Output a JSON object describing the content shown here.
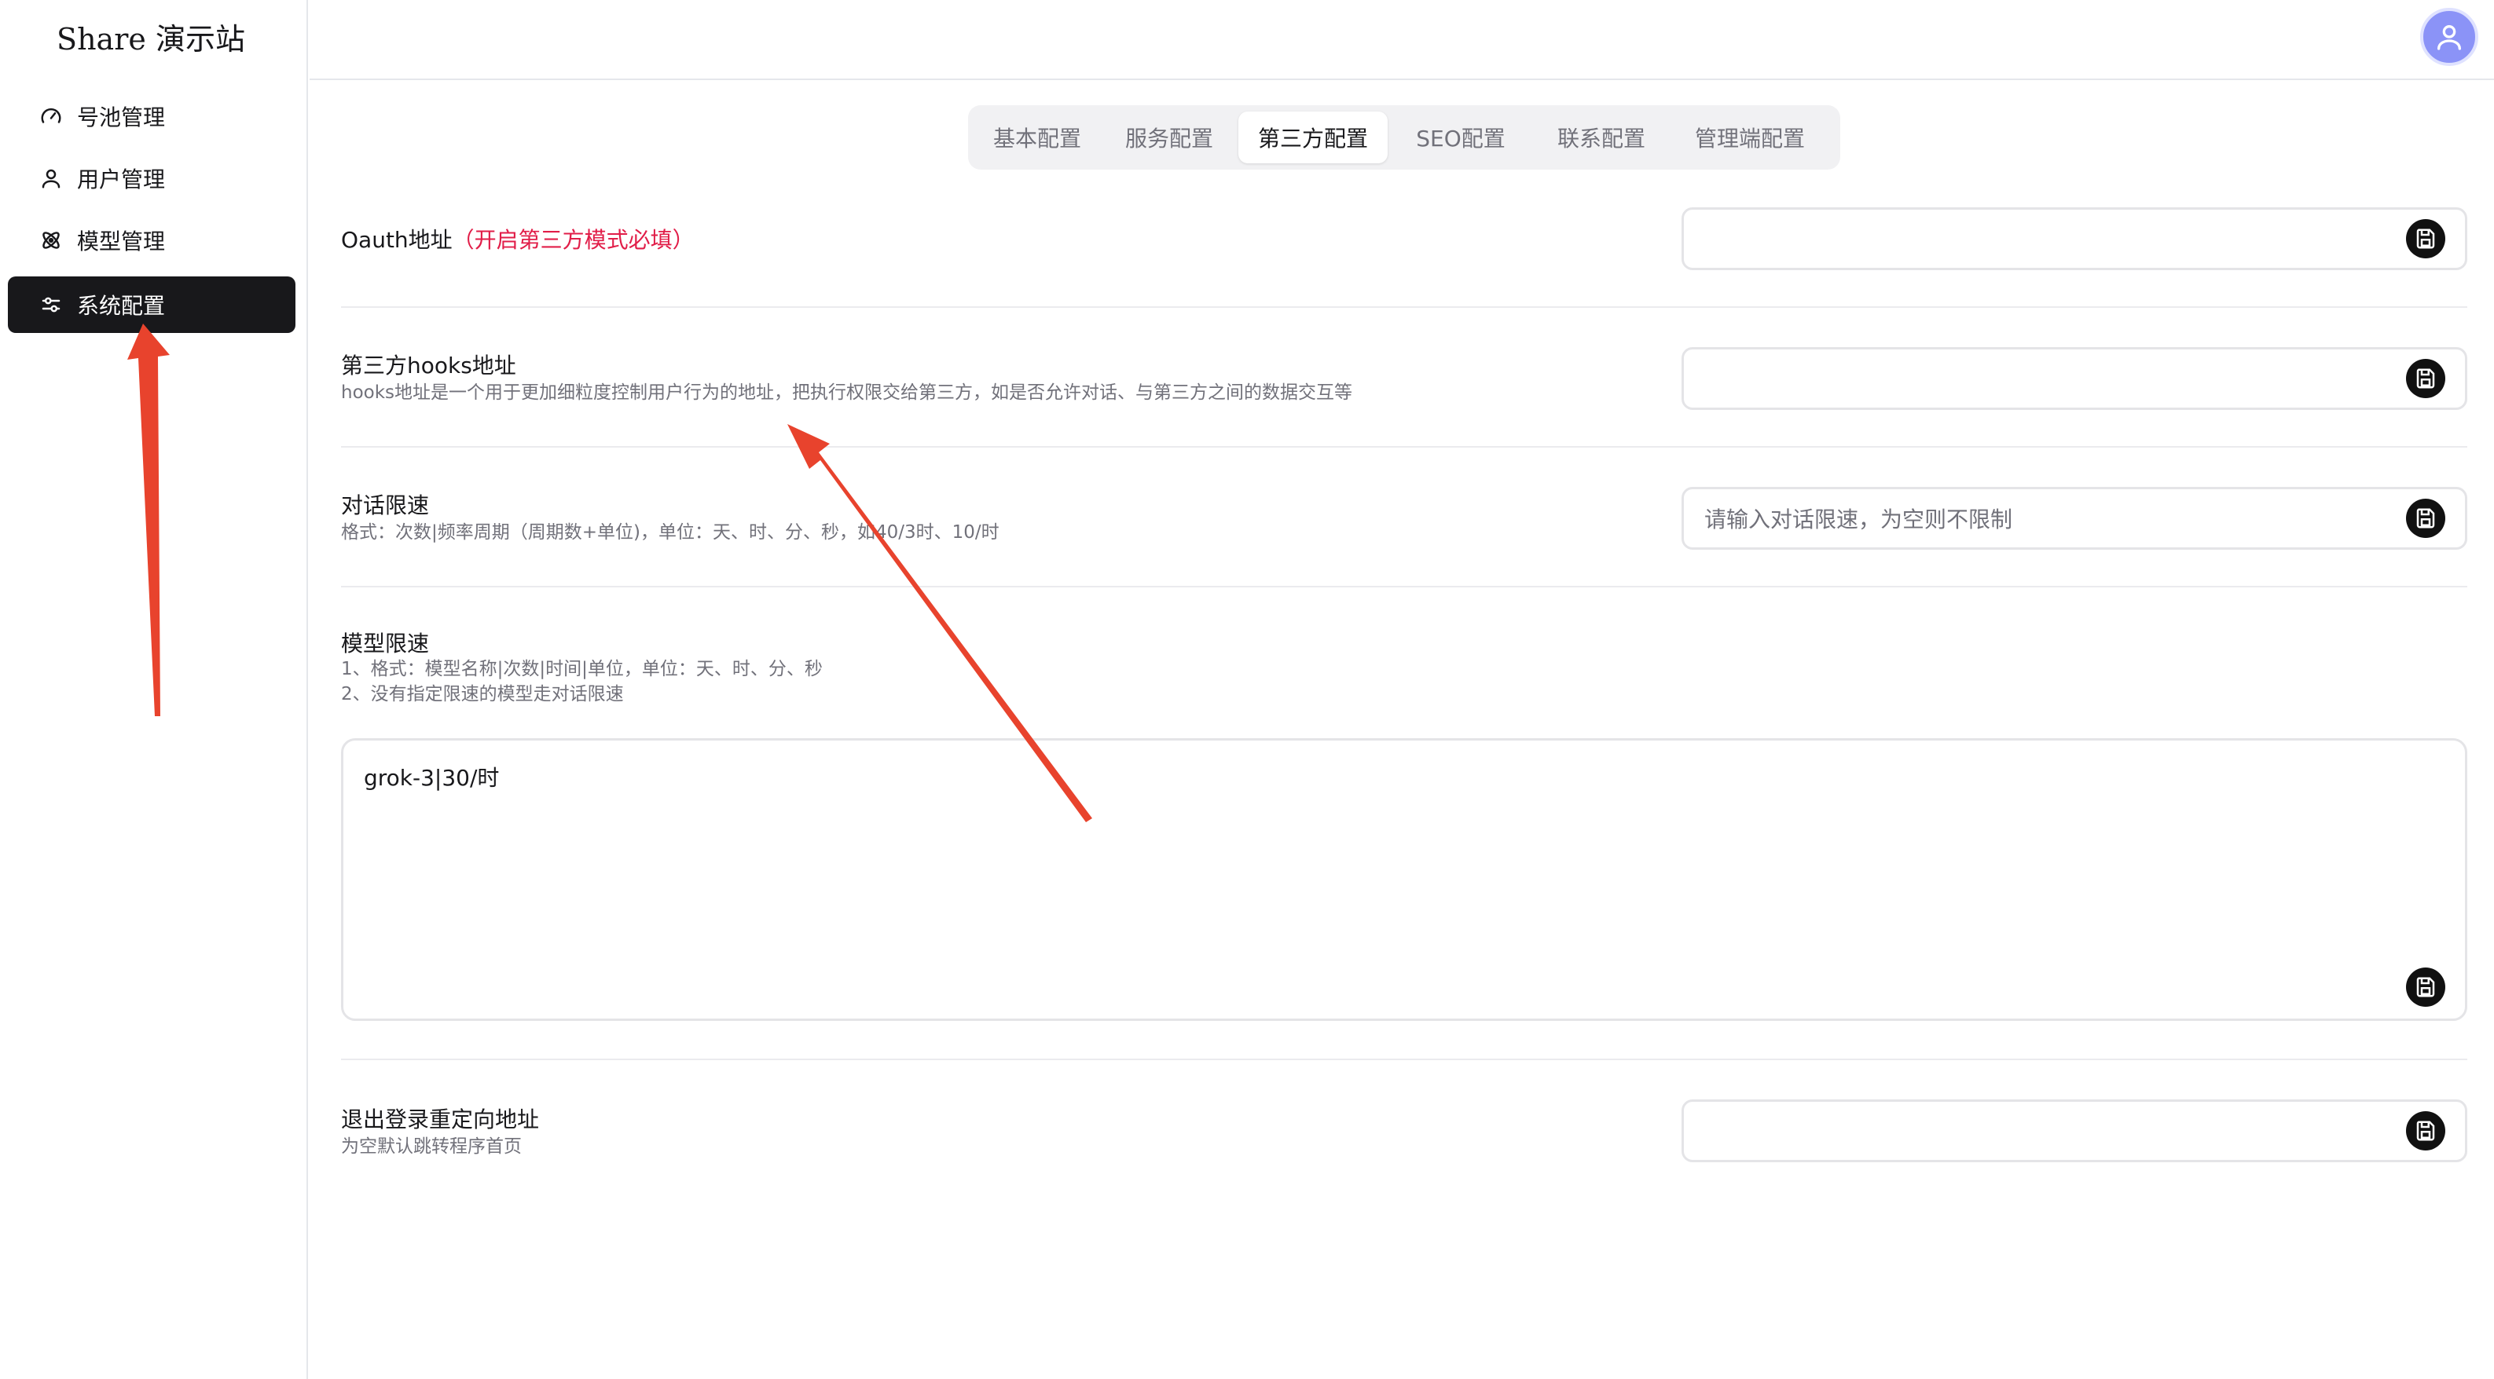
{
  "sidebar": {
    "brand": "Share 演示站",
    "items": [
      {
        "label": "号池管理",
        "icon": "gauge-icon"
      },
      {
        "label": "用户管理",
        "icon": "user-icon"
      },
      {
        "label": "模型管理",
        "icon": "atom-icon"
      },
      {
        "label": "系统配置",
        "icon": "sliders-icon",
        "active": true
      }
    ]
  },
  "header": {
    "avatar_icon": "user-avatar-icon"
  },
  "tabs": [
    {
      "label": "基本配置"
    },
    {
      "label": "服务配置"
    },
    {
      "label": "第三方配置",
      "active": true
    },
    {
      "label": "SEO配置"
    },
    {
      "label": "联系配置"
    },
    {
      "label": "管理端配置"
    }
  ],
  "settings": {
    "oauth": {
      "label": "Oauth地址",
      "required_note": "（开启第三方模式必填）",
      "value": ""
    },
    "hooks": {
      "label": "第三方hooks地址",
      "description": "hooks地址是一个用于更加细粒度控制用户行为的地址，把执行权限交给第三方，如是否允许对话、与第三方之间的数据交互等",
      "value": ""
    },
    "rate_limit": {
      "label": "对话限速",
      "description": "格式：次数|频率周期（周期数+单位)，单位：天、时、分、秒，如40/3时、10/时",
      "placeholder": "请输入对话限速，为空则不限制",
      "value": ""
    },
    "model_limit": {
      "label": "模型限速",
      "description_1": "1、格式：模型名称|次数|时间|单位，单位：天、时、分、秒",
      "description_2": "2、没有指定限速的模型走对话限速",
      "value": "grok-3|30/时"
    },
    "logout_redirect": {
      "label": "退出登录重定向地址",
      "description": "为空默认跳转程序首页",
      "value": ""
    }
  },
  "save_icon": "save-icon",
  "annotation_color": "#e8432d"
}
